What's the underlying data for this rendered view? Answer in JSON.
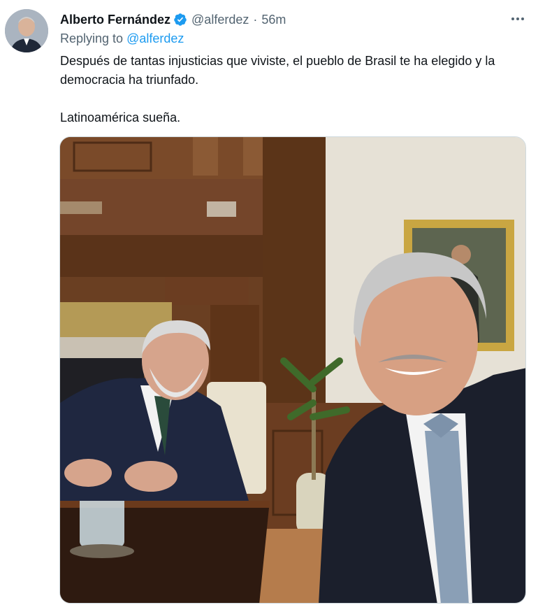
{
  "tweet": {
    "display_name": "Alberto Fernández",
    "handle": "@alferdez",
    "separator": "·",
    "time": "56m",
    "reply_prefix": "Replying to",
    "reply_handle": "@alferdez",
    "text": "Después de tantas injusticias que viviste, el pueblo de Brasil te ha elegido y la democracia ha triunfado.\n\nLatinoamérica sueña.",
    "icons": {
      "verified": "verified-badge-icon",
      "more": "more-options-icon"
    },
    "colors": {
      "accent": "#1d9bf0",
      "secondary_text": "#536471"
    }
  }
}
